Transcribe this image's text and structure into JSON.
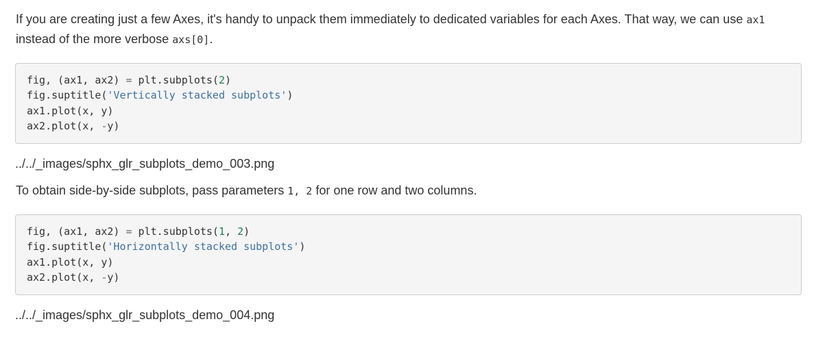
{
  "paragraph1": {
    "text_before": "If you are creating just a few Axes, it's handy to unpack them immediately to dedicated variables for each Axes. That way, we can use ",
    "code1": "ax1",
    "text_middle": " instead of the more verbose ",
    "code2": "axs[0]",
    "text_after": "."
  },
  "code_block_1": {
    "lines": [
      [
        {
          "t": "fig, (ax1, ax2) ",
          "c": "plain"
        },
        {
          "t": "=",
          "c": "op"
        },
        {
          "t": " plt.subplots(",
          "c": "plain"
        },
        {
          "t": "2",
          "c": "num"
        },
        {
          "t": ")",
          "c": "plain"
        }
      ],
      [
        {
          "t": "fig.suptitle(",
          "c": "plain"
        },
        {
          "t": "'Vertically stacked subplots'",
          "c": "str"
        },
        {
          "t": ")",
          "c": "plain"
        }
      ],
      [
        {
          "t": "ax1.plot(x, y)",
          "c": "plain"
        }
      ],
      [
        {
          "t": "ax2.plot(x, ",
          "c": "plain"
        },
        {
          "t": "-",
          "c": "op"
        },
        {
          "t": "y)",
          "c": "plain"
        }
      ]
    ]
  },
  "image_ref_1": "../../_images/sphx_glr_subplots_demo_003.png",
  "paragraph2": {
    "text_before": "To obtain side-by-side subplots, pass parameters ",
    "code": "1, 2",
    "text_after": " for one row and two columns."
  },
  "code_block_2": {
    "lines": [
      [
        {
          "t": "fig, (ax1, ax2) ",
          "c": "plain"
        },
        {
          "t": "=",
          "c": "op"
        },
        {
          "t": " plt.subplots(",
          "c": "plain"
        },
        {
          "t": "1",
          "c": "num"
        },
        {
          "t": ", ",
          "c": "plain"
        },
        {
          "t": "2",
          "c": "num"
        },
        {
          "t": ")",
          "c": "plain"
        }
      ],
      [
        {
          "t": "fig.suptitle(",
          "c": "plain"
        },
        {
          "t": "'Horizontally stacked subplots'",
          "c": "str"
        },
        {
          "t": ")",
          "c": "plain"
        }
      ],
      [
        {
          "t": "ax1.plot(x, y)",
          "c": "plain"
        }
      ],
      [
        {
          "t": "ax2.plot(x, ",
          "c": "plain"
        },
        {
          "t": "-",
          "c": "op"
        },
        {
          "t": "y)",
          "c": "plain"
        }
      ]
    ]
  },
  "image_ref_2": "../../_images/sphx_glr_subplots_demo_004.png",
  "colors": {
    "text": "#333333",
    "code_bg": "#f5f5f5",
    "code_border": "#cccccc",
    "string": "#4070a0",
    "number": "#208050",
    "operator": "#666666"
  }
}
